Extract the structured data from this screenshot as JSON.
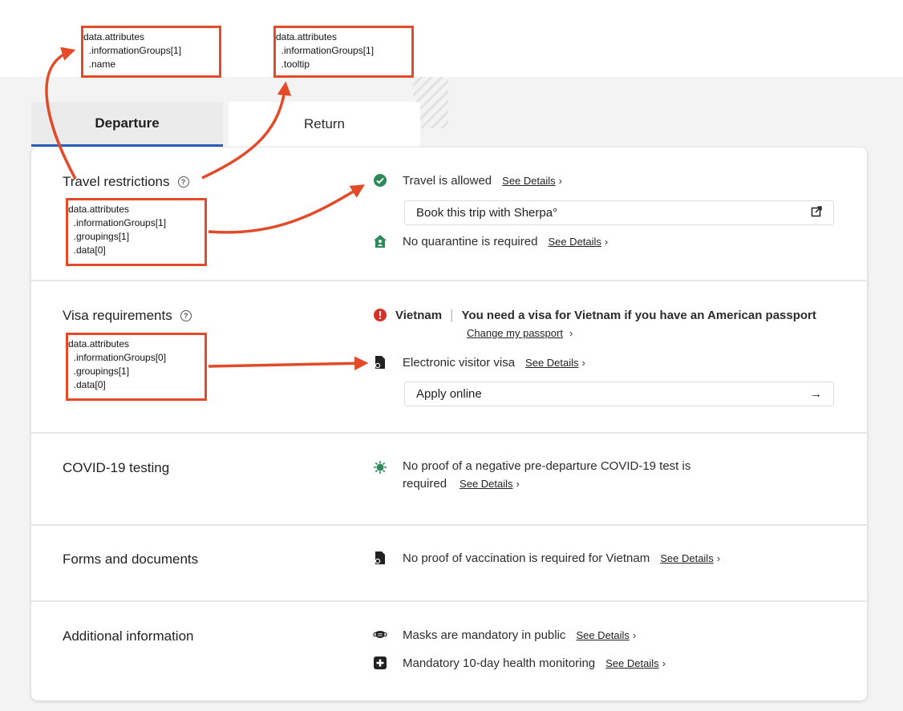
{
  "tabs": {
    "departure": "Departure",
    "return": "Return"
  },
  "sections": {
    "travel": {
      "title": "Travel restrictions",
      "status": "Travel is allowed",
      "see_details": "See Details",
      "button": "Book this trip with Sherpa°",
      "quarantine": "No quarantine is required",
      "quarantine_see": "See Details"
    },
    "visa": {
      "title": "Visa requirements",
      "country": "Vietnam",
      "message": "You need a visa for Vietnam if you have an American passport",
      "change_passport": "Change my passport",
      "type": "Electronic visitor visa",
      "see_details": "See Details",
      "button": "Apply online"
    },
    "covid": {
      "title": "COVID-19 testing",
      "text_line1": "No proof of a negative pre-departure COVID-19 test is",
      "text_line2": "required",
      "see_details": "See Details"
    },
    "forms": {
      "title": "Forms and documents",
      "text": "No proof of vaccination is required for Vietnam",
      "see_details": "See Details"
    },
    "additional": {
      "title": "Additional information",
      "masks": "Masks are mandatory in public",
      "masks_see": "See Details",
      "monitoring": "Mandatory 10-day health monitoring",
      "monitoring_see": "See Details"
    }
  },
  "annotations": {
    "name": [
      "data.attributes",
      "  .informationGroups[1]",
      "  .name"
    ],
    "tooltip": [
      "data.attributes",
      "  .informationGroups[1]",
      "  .tooltip"
    ],
    "travel_data": [
      "data.attributes",
      "  .informationGroups[1]",
      "  .groupings[1]",
      "  .data[0]"
    ],
    "visa_data": [
      "data.attributes",
      "  .informationGroups[0]",
      "  .groupings[1]",
      "  .data[0]"
    ]
  },
  "colors": {
    "accent": "#2a5fb8",
    "annotation": "#e24a28",
    "success": "#2e8b57",
    "error": "#d93025"
  }
}
